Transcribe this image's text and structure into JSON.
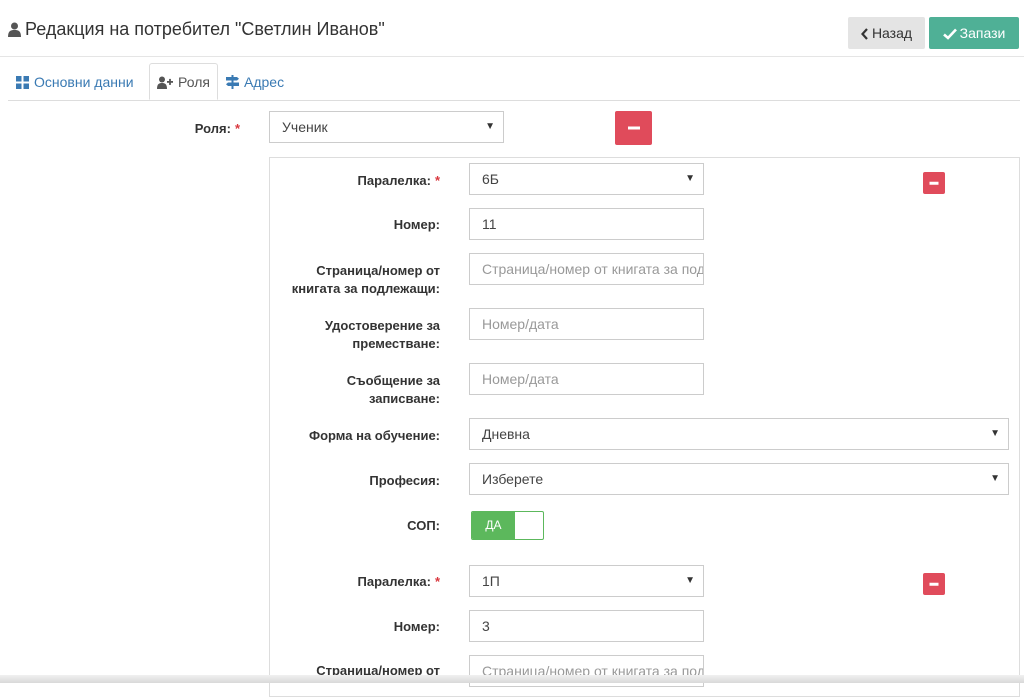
{
  "header": {
    "title": "Редакция на потребител \"Светлин Иванов\"",
    "back_label": "Назад",
    "save_label": "Запази"
  },
  "tabs": [
    {
      "label": "Основни данни",
      "active": false,
      "icon": "grid-icon"
    },
    {
      "label": "Роля",
      "active": true,
      "icon": "user-plus-icon"
    },
    {
      "label": "Адрес",
      "active": false,
      "icon": "signpost-icon"
    }
  ],
  "role": {
    "label": "Роля:",
    "required_mark": "*",
    "value": "Ученик"
  },
  "class_groups": [
    {
      "class_label": "Паралелка:",
      "class_value": "6Б",
      "number_label": "Номер:",
      "number_value": "11",
      "page_label": "Страница/номер от книгата за подлежащи:",
      "page_placeholder": "Страница/номер от книгата за подлежащи",
      "cert_label": "Удостоверение за преместване:",
      "cert_placeholder": "Номер/дата",
      "msg_label": "Съобщение за записване:",
      "msg_placeholder": "Номер/дата",
      "form_label": "Форма на обучение:",
      "form_value": "Дневна",
      "prof_label": "Професия:",
      "prof_value": "Изберете",
      "sop_label": "СОП:",
      "sop_value": "ДА"
    },
    {
      "class_label": "Паралелка:",
      "class_value": "1П",
      "number_label": "Номер:",
      "number_value": "3",
      "page_label": "Страница/номер от",
      "page_placeholder": "Страница/номер от книгата за подлежащи"
    }
  ],
  "colors": {
    "accent_save": "#4fb096",
    "danger": "#e04b5b",
    "toggle_on": "#5cb85c",
    "link": "#3a7ab3",
    "required": "#d9383f"
  }
}
